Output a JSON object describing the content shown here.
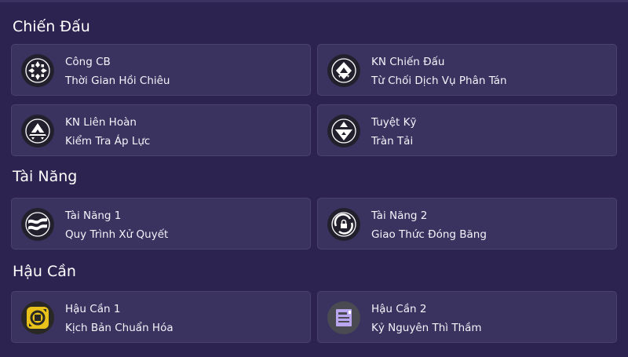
{
  "sections": {
    "combat": {
      "title": "Chiến Đấu",
      "cards": [
        {
          "title": "Công CB",
          "subtitle": "Thời Gian Hồi Chiêu",
          "icon": "basic-attack-icon"
        },
        {
          "title": "KN Chiến Đấu",
          "subtitle": "Từ Chối Dịch Vụ Phân Tán",
          "icon": "combat-skill-icon"
        },
        {
          "title": "KN Liên Hoàn",
          "subtitle": "Kiểm Tra Áp Lực",
          "icon": "combo-skill-icon"
        },
        {
          "title": "Tuyệt Kỹ",
          "subtitle": "Tràn Tải",
          "icon": "ultimate-icon"
        }
      ]
    },
    "talent": {
      "title": "Tài Năng",
      "cards": [
        {
          "title": "Tài Năng 1",
          "subtitle": "Quy Trình Xử Quyết",
          "icon": "talent-wave-icon"
        },
        {
          "title": "Tài Năng 2",
          "subtitle": "Giao Thức Đóng Băng",
          "icon": "talent-lock-icon"
        }
      ]
    },
    "logistics": {
      "title": "Hậu Cần",
      "cards": [
        {
          "title": "Hậu Cần 1",
          "subtitle": "Kịch Bản Chuẩn Hóa",
          "icon": "logistics-gear-icon"
        },
        {
          "title": "Hậu Cần 2",
          "subtitle": "Kỷ Nguyên Thì Thầm",
          "icon": "logistics-device-icon"
        }
      ]
    }
  },
  "colors": {
    "background": "#2c2350",
    "card": "#3b335f",
    "card_border": "#4a426f",
    "gold": "#e8c21a",
    "lavender": "#b9a6ee"
  }
}
